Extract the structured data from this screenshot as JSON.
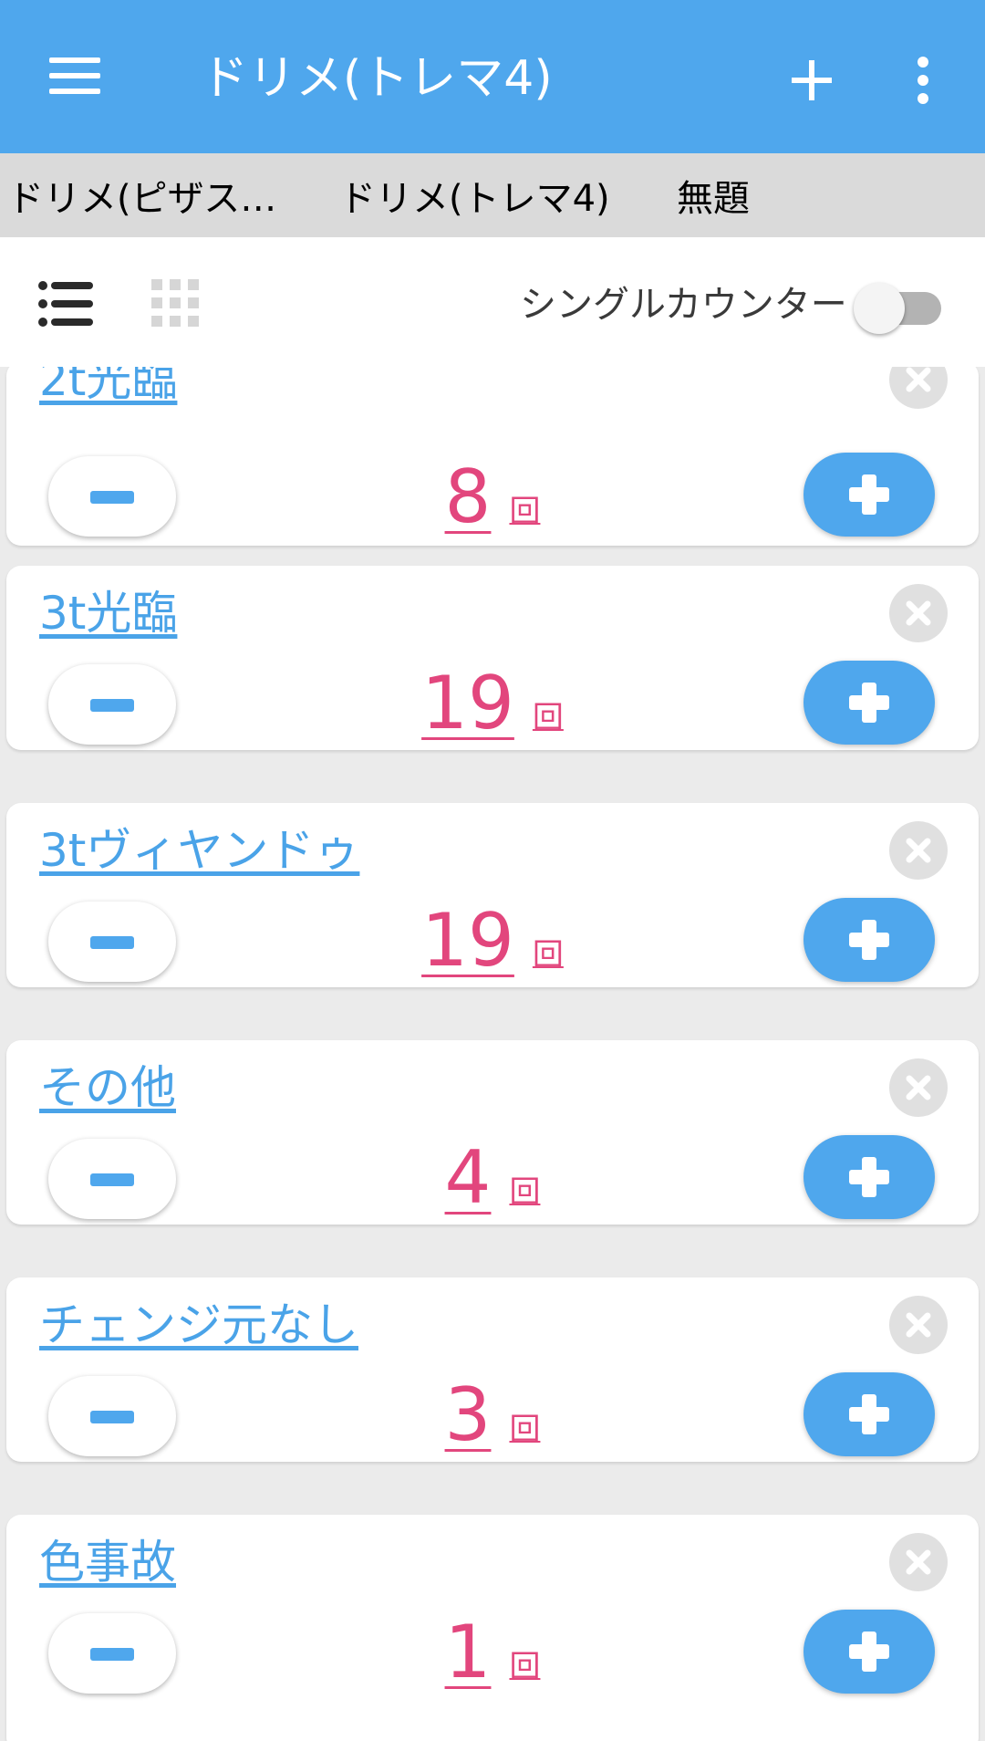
{
  "appbar": {
    "title": "ドリメ(トレマ4)",
    "menu_icon": "hamburger-menu-icon",
    "add_icon": "plus-icon",
    "more_icon": "vertical-dots-icon",
    "background_color": "#4fa7ed"
  },
  "tabs": [
    {
      "label": "ドリメ(ピザス…",
      "active": false
    },
    {
      "label": "ドリメ(トレマ4)",
      "active": true
    },
    {
      "label": "無題",
      "active": false
    }
  ],
  "toolbar": {
    "list_view_icon": "list-view-icon",
    "grid_view_icon": "grid-view-icon",
    "single_counter_label": "シングルカウンター",
    "single_counter_enabled": false
  },
  "counters": [
    {
      "name": "2t光臨",
      "count": "8",
      "unit": "回"
    },
    {
      "name": "3t光臨",
      "count": "19",
      "unit": "回"
    },
    {
      "name": "3tヴィヤンドゥ",
      "count": "19",
      "unit": "回"
    },
    {
      "name": "その他",
      "count": "4",
      "unit": "回"
    },
    {
      "name": "チェンジ元なし",
      "count": "3",
      "unit": "回"
    },
    {
      "name": "色事故",
      "count": "1",
      "unit": "回"
    }
  ],
  "colors": {
    "accent": "#4fa7ed",
    "count_text": "#e2467d",
    "name_text": "#4aa3e8"
  }
}
